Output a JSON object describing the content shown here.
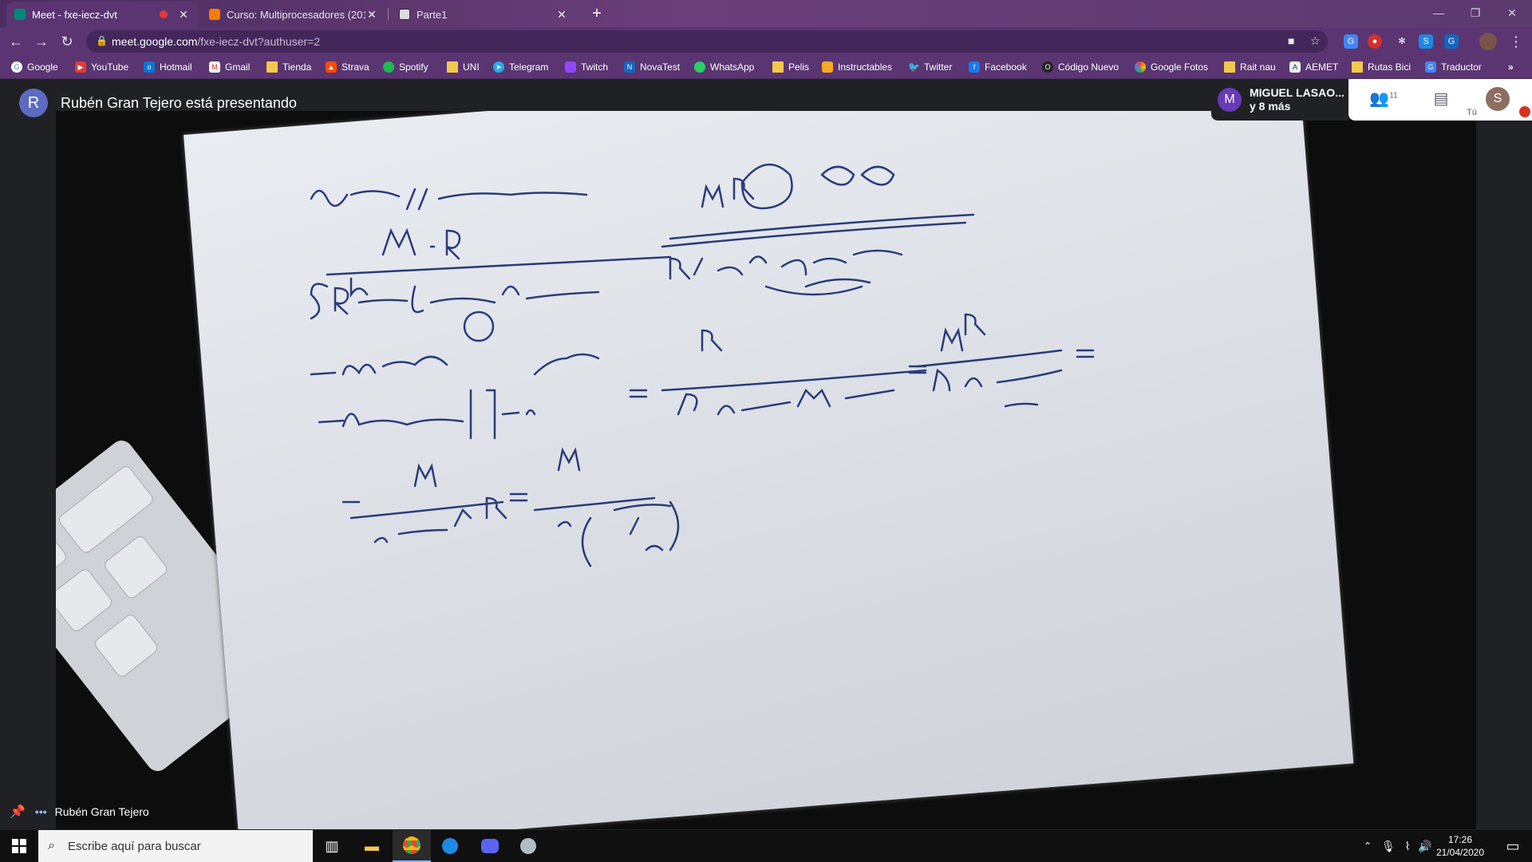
{
  "tabs": [
    {
      "title": "Meet - fxe-iecz-dvt",
      "recording": true,
      "active": true
    },
    {
      "title": "Curso: Multiprocesadores (2019-",
      "active": false
    },
    {
      "title": "Parte1",
      "active": false
    }
  ],
  "address": {
    "url_host": "meet.google.com",
    "url_path": "/fxe-iecz-dvt?authuser=2"
  },
  "bookmarks": [
    {
      "label": "Google"
    },
    {
      "label": "YouTube"
    },
    {
      "label": "Hotmail"
    },
    {
      "label": "Gmail"
    },
    {
      "label": "Tienda"
    },
    {
      "label": "Strava"
    },
    {
      "label": "Spotify"
    },
    {
      "label": "UNI"
    },
    {
      "label": "Telegram"
    },
    {
      "label": "Twitch"
    },
    {
      "label": "NovaTest"
    },
    {
      "label": "WhatsApp"
    },
    {
      "label": "Pelis"
    },
    {
      "label": "Instructables"
    },
    {
      "label": "Twitter"
    },
    {
      "label": "Facebook"
    },
    {
      "label": "Código Nuevo"
    },
    {
      "label": "Google Fotos"
    },
    {
      "label": "Rait nau"
    },
    {
      "label": "AEMET"
    },
    {
      "label": "Rutas Bici"
    },
    {
      "label": "Traductor"
    }
  ],
  "meet": {
    "presenter_initial": "R",
    "presenter_banner": "Rubén Gran Tejero está presentando",
    "participant_initial": "M",
    "participant_name": "MIGUEL LASAO...",
    "participant_more": "y 8 más",
    "people_count": "11",
    "self_initial": "S",
    "self_label": "Tú",
    "bottom_name": "Rubén Gran Tejero"
  },
  "taskbar": {
    "search_placeholder": "Escribe aquí para buscar",
    "time": "17:26",
    "date": "21/04/2020"
  },
  "colors": {
    "tab_strip": "#5a3572",
    "meet_bg": "#202124",
    "presenter_avatar": "#5c6bc0",
    "participant_avatar": "#673ab7",
    "self_avatar": "#8d6e63"
  }
}
